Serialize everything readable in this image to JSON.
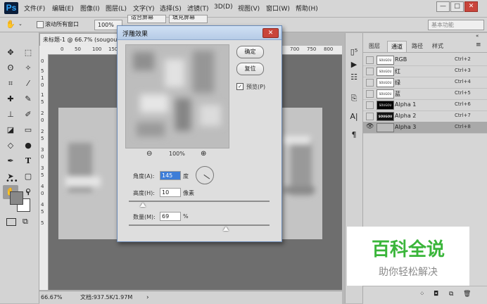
{
  "app": {
    "logo": "Ps"
  },
  "menu": [
    "文件(F)",
    "编辑(E)",
    "图像(I)",
    "图层(L)",
    "文字(Y)",
    "选择(S)",
    "滤镜(T)",
    "3D(D)",
    "视图(V)",
    "窗口(W)",
    "帮助(H)"
  ],
  "window_controls": {
    "minimize": "—",
    "maximize": "□",
    "close": "✕"
  },
  "options_bar": {
    "scroll_all_label": "滚动所有窗口",
    "zoom": "100%",
    "fit_screen": "适合屏幕",
    "fill_screen": "填充屏幕",
    "workspace": "基本功能"
  },
  "document": {
    "tab_title": "未标题-1 @ 66.7% (sougou",
    "ruler_top": [
      "0",
      "50",
      "100",
      "150",
      "700",
      "750",
      "800"
    ],
    "ruler_left": [
      "0",
      "5",
      "1",
      "0",
      "1",
      "5",
      "2",
      "0",
      "2",
      "5",
      "3",
      "0",
      "3",
      "5",
      "4",
      "0",
      "4",
      "5",
      "5"
    ],
    "zoom": "66.67%",
    "doc_info": "文档:937.5K/1.97M"
  },
  "dialog": {
    "title": "浮雕效果",
    "ok": "确定",
    "reset": "复位",
    "preview_label": "预览(P)",
    "preview_checked": true,
    "zoom": "100%",
    "angle_label": "角度(A):",
    "angle_value": "145",
    "angle_unit": "度",
    "height_label": "高度(H):",
    "height_value": "10",
    "height_unit": "像素",
    "amount_label": "数量(M):",
    "amount_value": "69",
    "amount_unit": "%",
    "height_slider_fraction": 0.1,
    "amount_slider_fraction": 0.69
  },
  "panel": {
    "tabs": [
      "图层",
      "通道",
      "路径",
      "样式"
    ],
    "active_tab": "通道",
    "channels": [
      {
        "name": "RGB",
        "shortcut": "Ctrl+2",
        "thumb": "SOUGOU",
        "selected": false
      },
      {
        "name": "红",
        "shortcut": "Ctrl+3",
        "thumb": "SOUGOU",
        "selected": false
      },
      {
        "name": "绿",
        "shortcut": "Ctrl+4",
        "thumb": "SOUGOU",
        "selected": false
      },
      {
        "name": "蓝",
        "shortcut": "Ctrl+5",
        "thumb": "SOUGOU",
        "selected": false
      },
      {
        "name": "Alpha 1",
        "shortcut": "Ctrl+6",
        "thumb": "SOUGOU",
        "selected": false
      },
      {
        "name": "Alpha 2",
        "shortcut": "Ctrl+7",
        "thumb": "SOUGOU",
        "selected": false
      },
      {
        "name": "Alpha 3",
        "shortcut": "Ctrl+8",
        "thumb": "",
        "selected": true
      }
    ]
  },
  "watermark": {
    "title": "百科全说",
    "subtitle": "助你轻松解决"
  },
  "icons": {
    "move": "move-icon",
    "marquee": "marquee-icon",
    "lasso": "lasso-icon",
    "magic": "magic-wand-icon",
    "crop": "crop-icon",
    "eyedropper": "eyedropper-icon",
    "heal": "healing-icon",
    "brush": "brush-icon",
    "stamp": "stamp-icon",
    "history": "history-brush-icon",
    "eraser": "eraser-icon",
    "gradient": "gradient-icon",
    "blur": "blur-icon",
    "dodge": "dodge-icon",
    "pen": "pen-icon",
    "type": "type-icon",
    "select": "path-select-icon",
    "shape": "rectangle-icon",
    "hand": "hand-icon",
    "zoom": "zoom-icon"
  },
  "colors": {
    "title_bar": "#b6cbe6",
    "close": "#c9453b",
    "watermark_green": "#3ab53a"
  }
}
